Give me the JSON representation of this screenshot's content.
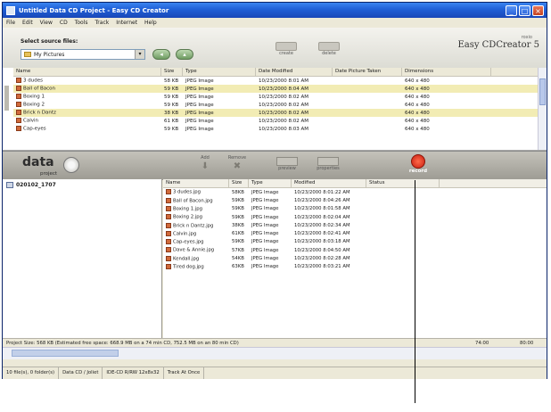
{
  "window": {
    "title": "Untitled Data CD Project - Easy CD Creator",
    "buttons": {
      "minimize": "_",
      "maximize": "□",
      "close": "×"
    }
  },
  "menu": [
    "File",
    "Edit",
    "View",
    "CD",
    "Tools",
    "Track",
    "Internet",
    "Help"
  ],
  "source": {
    "label": "Select source files:",
    "selected": "My Pictures",
    "toolbar": [
      {
        "label": "create"
      },
      {
        "label": "delete"
      }
    ]
  },
  "logo": {
    "text": "Easy CDCreator 5",
    "brand": "roxio"
  },
  "top_table": {
    "columns": [
      "Name",
      "Size",
      "Type",
      "Date Modified",
      "Date Picture Taken",
      "Dimensions"
    ],
    "rows": [
      [
        "3 dudes",
        "58 KB",
        "JPEG Image",
        "10/23/2000 8:01 AM",
        "",
        "640 x 480"
      ],
      [
        "Ball of Bacon",
        "59 KB",
        "JPEG Image",
        "10/23/2000 8:04 AM",
        "",
        "640 x 480"
      ],
      [
        "Boxing 1",
        "59 KB",
        "JPEG Image",
        "10/23/2000 8:02 AM",
        "",
        "640 x 480"
      ],
      [
        "Boxing 2",
        "59 KB",
        "JPEG Image",
        "10/23/2000 8:02 AM",
        "",
        "640 x 480"
      ],
      [
        "Brick n Dantz",
        "38 KB",
        "JPEG Image",
        "10/23/2000 8:02 AM",
        "",
        "640 x 480"
      ],
      [
        "Calvin",
        "61 KB",
        "JPEG Image",
        "10/23/2000 8:02 AM",
        "",
        "640 x 480"
      ],
      [
        "Cap-eyes",
        "59 KB",
        "JPEG Image",
        "10/23/2000 8:03 AM",
        "",
        "640 x 480"
      ]
    ]
  },
  "project": {
    "title": "data",
    "subtitle": "project",
    "buttons": [
      {
        "label": "Add"
      },
      {
        "label": "Remove"
      },
      {
        "label": "preview"
      },
      {
        "label": "properties"
      }
    ],
    "record_label": "record"
  },
  "tree": {
    "root": "020102_1707"
  },
  "lower_table": {
    "columns": [
      "Name",
      "Size",
      "Type",
      "Modified",
      "Status"
    ],
    "rows": [
      [
        "3 dudes.jpg",
        "58KB",
        "JPEG Image",
        "10/23/2000 8:01:22 AM"
      ],
      [
        "Ball of Bacon.jpg",
        "59KB",
        "JPEG Image",
        "10/23/2000 8:04:26 AM"
      ],
      [
        "Boxing 1.jpg",
        "59KB",
        "JPEG Image",
        "10/23/2000 8:01:58 AM"
      ],
      [
        "Boxing 2.jpg",
        "59KB",
        "JPEG Image",
        "10/23/2000 8:02:04 AM"
      ],
      [
        "Brick n Dantz.jpg",
        "38KB",
        "JPEG Image",
        "10/23/2000 8:02:34 AM"
      ],
      [
        "Calvin.jpg",
        "61KB",
        "JPEG Image",
        "10/23/2000 8:02:41 AM"
      ],
      [
        "Cap-eyes.jpg",
        "59KB",
        "JPEG Image",
        "10/23/2000 8:03:18 AM"
      ],
      [
        "Dave & Annie.jpg",
        "57KB",
        "JPEG Image",
        "10/23/2000 8:04:50 AM"
      ],
      [
        "Kendall.jpg",
        "54KB",
        "JPEG Image",
        "10/23/2000 8:02:28 AM"
      ],
      [
        "Tired dog.jpg",
        "63KB",
        "JPEG Image",
        "10/23/2000 8:03:21 AM"
      ]
    ]
  },
  "project_size": {
    "text": "Project Size: 568 KB   (Estimated free space: 668.9 MB on a 74 min CD,  752.5 MB on an 80 min CD)",
    "min74": "74:00",
    "min80": "80:00"
  },
  "status": {
    "files": "10 file(s), 0 folder(s)",
    "mode": "Data CD / Joliet",
    "drive": "IDE-CD R/RW 12x8x32",
    "track": "Track At Once"
  },
  "colors": {
    "title_blue": "#1f5fd6",
    "record_red": "#c81e10",
    "highlight": "#f2ecb4"
  }
}
